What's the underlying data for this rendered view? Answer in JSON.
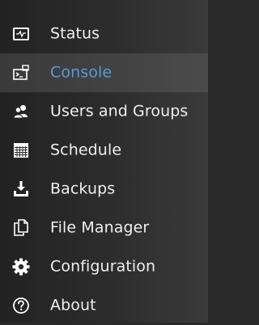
{
  "sidebar": {
    "items": [
      {
        "label": "Status",
        "icon": "status-monitor-icon",
        "active": false
      },
      {
        "label": "Console",
        "icon": "console-icon",
        "active": true
      },
      {
        "label": "Users and Groups",
        "icon": "users-icon",
        "active": false
      },
      {
        "label": "Schedule",
        "icon": "calendar-icon",
        "active": false
      },
      {
        "label": "Backups",
        "icon": "download-tray-icon",
        "active": false
      },
      {
        "label": "File Manager",
        "icon": "file-copy-icon",
        "active": false
      },
      {
        "label": "Configuration",
        "icon": "gear-icon",
        "active": false
      },
      {
        "label": "About",
        "icon": "question-circle-icon",
        "active": false
      }
    ]
  },
  "colors": {
    "text": "#efefef",
    "active_text": "#5b9bd5",
    "background": "#2a2a2a",
    "active_background": "#434343"
  }
}
